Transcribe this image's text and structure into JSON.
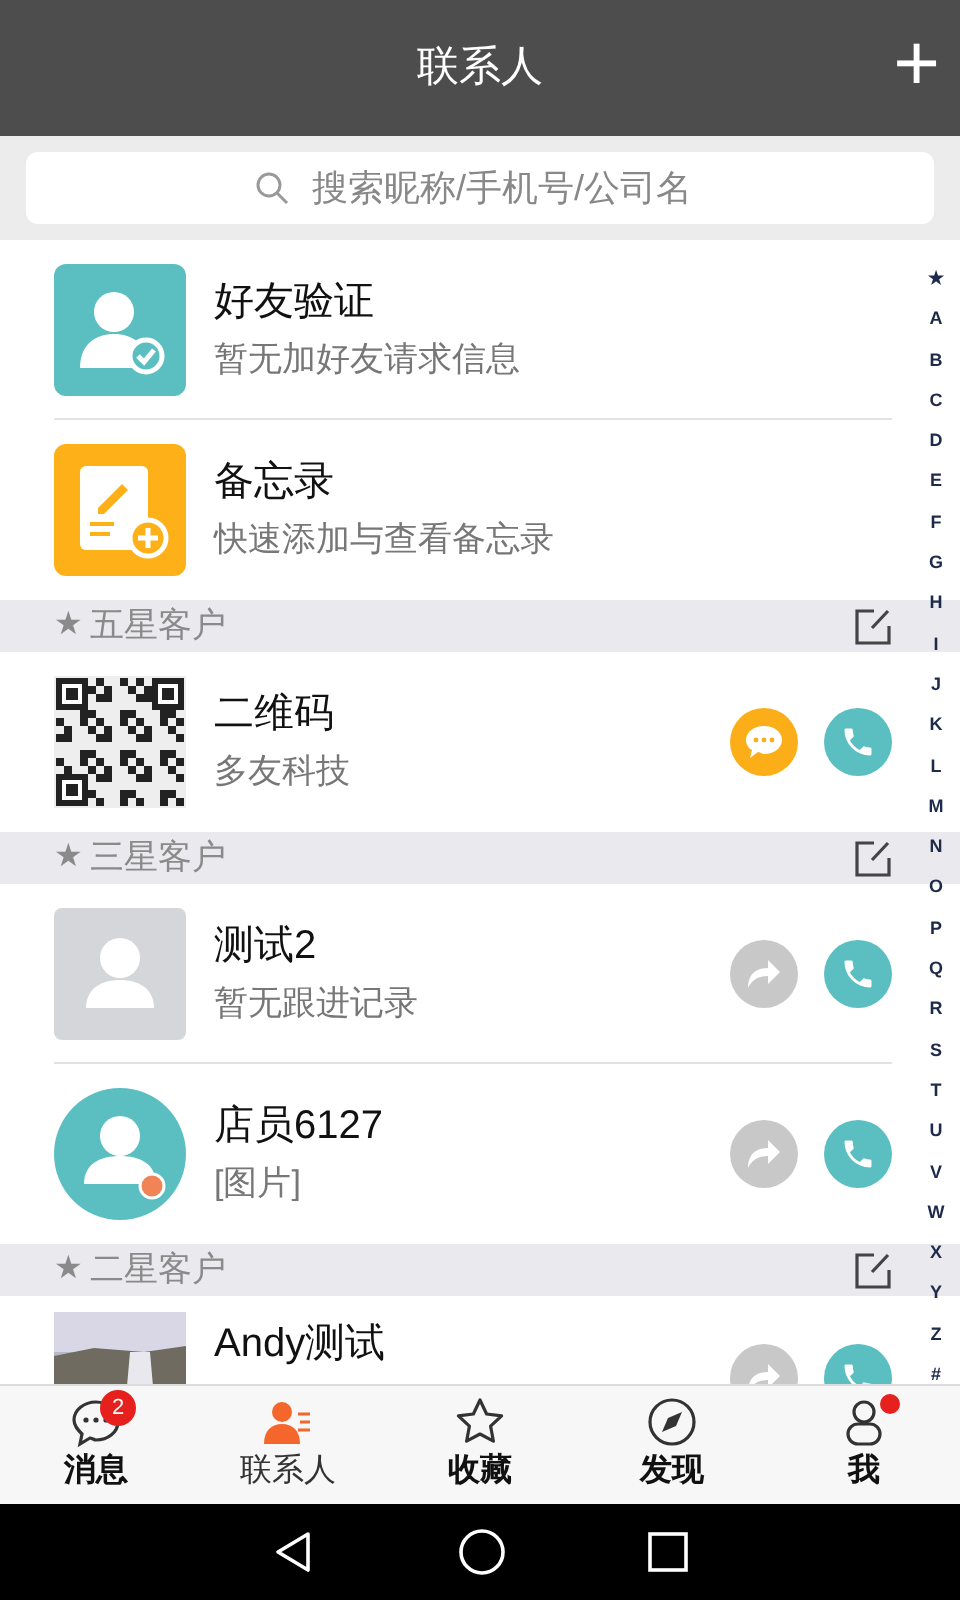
{
  "header": {
    "title": "联系人",
    "add_icon_text": "+"
  },
  "search": {
    "placeholder": "搜索昵称/手机号/公司名"
  },
  "list": [
    {
      "kind": "friend",
      "name": "好友验证",
      "subtitle": "暂无加好友请求信息"
    },
    {
      "kind": "memo",
      "name": "备忘录",
      "subtitle": "快速添加与查看备忘录"
    },
    {
      "kind": "section",
      "mark": "★",
      "title": "五星客户"
    },
    {
      "kind": "qr",
      "name": "二维码",
      "subtitle": "多友科技",
      "actions": [
        {
          "kind": "message"
        },
        {
          "kind": "call"
        }
      ]
    },
    {
      "kind": "section",
      "mark": "★",
      "title": "三星客户"
    },
    {
      "kind": "gray",
      "name": "测试2",
      "subtitle": "暂无跟进记录",
      "actions": [
        {
          "kind": "share"
        },
        {
          "kind": "call"
        }
      ]
    },
    {
      "kind": "round",
      "name": "店员6127",
      "subtitle": "[图片]",
      "actions": [
        {
          "kind": "share"
        },
        {
          "kind": "call"
        }
      ]
    },
    {
      "kind": "section",
      "mark": "★",
      "title": "二星客户"
    },
    {
      "kind": "picture",
      "name": "Andy测试",
      "actions": [
        {
          "kind": "share"
        },
        {
          "kind": "call"
        }
      ]
    }
  ],
  "index": [
    "★",
    "A",
    "B",
    "C",
    "D",
    "E",
    "F",
    "G",
    "H",
    "I",
    "J",
    "K",
    "L",
    "M",
    "N",
    "O",
    "P",
    "Q",
    "R",
    "S",
    "T",
    "U",
    "V",
    "W",
    "X",
    "Y",
    "Z",
    "#"
  ],
  "tabs": [
    {
      "label": "消息",
      "selected": false,
      "badge": "2"
    },
    {
      "label": "联系人",
      "selected": true
    },
    {
      "label": "收藏",
      "selected": false
    },
    {
      "label": "发现",
      "selected": false
    },
    {
      "label": "我",
      "selected": false,
      "dot": true
    }
  ]
}
